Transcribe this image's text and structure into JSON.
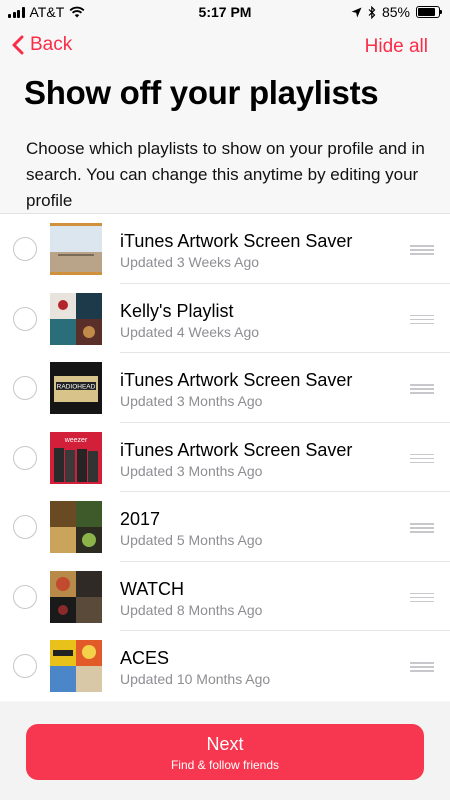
{
  "status": {
    "carrier": "AT&T",
    "time": "5:17 PM",
    "battery": "85%",
    "battery_level": 0.85
  },
  "nav": {
    "back_label": "Back",
    "hide_all_label": "Hide all"
  },
  "title": "Show off your playlists",
  "description": "Choose which playlists to show on your profile and in search. You can change this anytime by editing your profile",
  "playlists": [
    {
      "name": "iTunes Artwork Screen Saver",
      "updated": "Updated 3 Weeks Ago"
    },
    {
      "name": "Kelly's Playlist",
      "updated": "Updated 4 Weeks Ago"
    },
    {
      "name": "iTunes Artwork Screen Saver",
      "updated": "Updated 3 Months Ago"
    },
    {
      "name": "iTunes Artwork Screen Saver",
      "updated": "Updated 3 Months Ago"
    },
    {
      "name": "2017",
      "updated": "Updated 5 Months Ago"
    },
    {
      "name": "WATCH",
      "updated": "Updated 8 Months Ago"
    },
    {
      "name": "ACES",
      "updated": "Updated 10 Months Ago"
    }
  ],
  "footer": {
    "next_label": "Next",
    "next_sub": "Find & follow friends"
  },
  "colors": {
    "accent": "#fa2d48",
    "button": "#f7364f"
  }
}
